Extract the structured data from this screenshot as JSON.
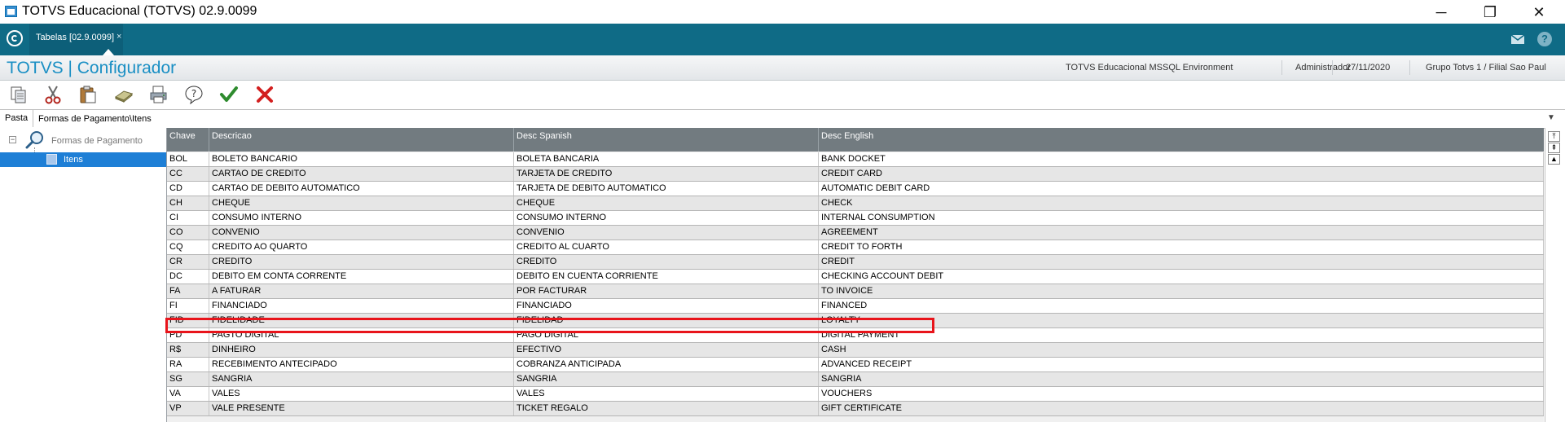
{
  "window": {
    "title": "TOTVS Educacional (TOTVS) 02.9.0099",
    "minimize": "─",
    "maximize": "❐",
    "close": "✕"
  },
  "tabs": [
    {
      "label": "Tabelas [02.9.0099]",
      "close": "×"
    }
  ],
  "header": {
    "title": "TOTVS | Configurador",
    "environment": "TOTVS Educacional MSSQL Environment",
    "user": "Administrador",
    "date": "27/11/2020",
    "branch": "Grupo Totvs 1 / Filial Sao Paul"
  },
  "toolbar_icons": [
    "copy-icon",
    "cut-icon",
    "paste-icon",
    "eraser-icon",
    "print-icon",
    "help-icon",
    "confirm-icon",
    "cancel-icon"
  ],
  "pathbar": {
    "label": "Pasta",
    "path": "Formas de Pagamento\\Itens",
    "dropdown": "▼"
  },
  "tree": {
    "expander": "−",
    "root_label": "Formas de Pagamento",
    "child_label": "Itens"
  },
  "grid": {
    "columns": [
      "Chave",
      "Descricao",
      "Desc Spanish",
      "Desc English"
    ],
    "rows": [
      [
        "BOL",
        "BOLETO BANCARIO",
        "BOLETA BANCARIA",
        "BANK DOCKET"
      ],
      [
        "CC",
        "CARTAO DE CREDITO",
        "TARJETA DE CREDITO",
        "CREDIT CARD"
      ],
      [
        "CD",
        "CARTAO DE DEBITO AUTOMATICO",
        "TARJETA DE DEBITO AUTOMATICO",
        "AUTOMATIC DEBIT CARD"
      ],
      [
        "CH",
        "CHEQUE",
        "CHEQUE",
        "CHECK"
      ],
      [
        "CI",
        "CONSUMO INTERNO",
        "CONSUMO INTERNO",
        "INTERNAL CONSUMPTION"
      ],
      [
        "CO",
        "CONVENIO",
        "CONVENIO",
        "AGREEMENT"
      ],
      [
        "CQ",
        "CREDITO AO QUARTO",
        "CREDITO AL CUARTO",
        "CREDIT TO FORTH"
      ],
      [
        "CR",
        "CREDITO",
        "CREDITO",
        "CREDIT"
      ],
      [
        "DC",
        "DEBITO EM CONTA CORRENTE",
        "DEBITO EN CUENTA CORRIENTE",
        "CHECKING ACCOUNT DEBIT"
      ],
      [
        "FA",
        "A FATURAR",
        "POR FACTURAR",
        "TO INVOICE"
      ],
      [
        "FI",
        "FINANCIADO",
        "FINANCIADO",
        "FINANCED"
      ],
      [
        "FID",
        "FIDELIDADE",
        "FIDELIDAD",
        "LOYALTY"
      ],
      [
        "PD",
        "PAGTO DIGITAL",
        "PAGO DIGITAL",
        "DIGITAL PAYMENT"
      ],
      [
        "R$",
        "DINHEIRO",
        "EFECTIVO",
        "CASH"
      ],
      [
        "RA",
        "RECEBIMENTO ANTECIPADO",
        "COBRANZA ANTICIPADA",
        "ADVANCED RECEIPT"
      ],
      [
        "SG",
        "SANGRIA",
        "SANGRIA",
        "SANGRIA"
      ],
      [
        "VA",
        "VALES",
        "VALES",
        "VOUCHERS"
      ],
      [
        "VP",
        "VALE PRESENTE",
        "TICKET REGALO",
        "GIFT CERTIFICATE"
      ]
    ]
  },
  "scrollbar": {
    "top": "⤒",
    "page_up": "⇞",
    "up": "▲"
  },
  "colors": {
    "tabbar": "#0f6b86",
    "header_title": "#1a8fc4",
    "grid_header": "#727b80",
    "selection": "#1e7fd6",
    "highlight": "#e8141b"
  }
}
